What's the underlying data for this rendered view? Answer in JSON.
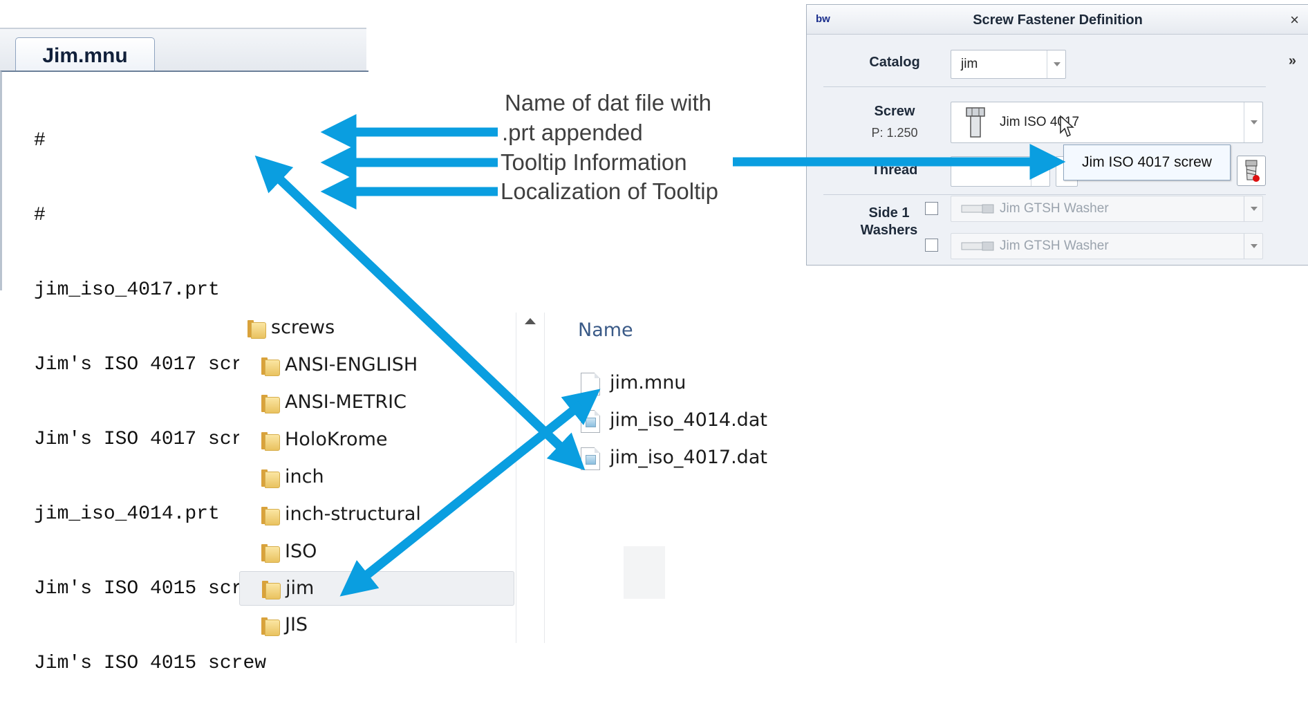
{
  "editor": {
    "tab_label": "Jim.mnu",
    "lines": [
      "#",
      "#",
      "jim_iso_4017.prt",
      "Jim's ISO 4017 screw",
      "Jim's ISO 4017 screw",
      "jim_iso_4014.prt",
      "Jim's ISO 4015 screw",
      "Jim's ISO 4015 screw"
    ]
  },
  "annotations": {
    "dat_name_line1": "Name of dat file with",
    "dat_name_line2": ".prt appended",
    "tooltip_info": "Tooltip Information",
    "tooltip_localization": "Localization of Tooltip"
  },
  "dialog": {
    "app_icon_label": "bw",
    "title": "Screw Fastener Definition",
    "close_label": "×",
    "expand_label": "»",
    "catalog_label": "Catalog",
    "catalog_value": "jim",
    "screw_label": "Screw",
    "pitch_label": "P: 1.250",
    "screw_value": "Jim ISO 4017",
    "thread_label": "Thread",
    "side1_label": "Side 1",
    "washers_label": "Washers",
    "washer1_value": "Jim GTSH Washer",
    "washer2_value": "Jim GTSH Washer",
    "tooltip_text": "Jim ISO 4017 screw"
  },
  "explorer": {
    "folders": [
      "screws",
      "ANSI-ENGLISH",
      "ANSI-METRIC",
      "HoloKrome",
      "inch",
      "inch-structural",
      "ISO",
      "jim",
      "JIS"
    ],
    "selected_folder": "jim",
    "name_header": "Name",
    "files": [
      "jim.mnu",
      "jim_iso_4014.dat",
      "jim_iso_4017.dat"
    ]
  },
  "colors": {
    "arrow": "#0a9ee0",
    "annotation_text": "#3f3f3f",
    "dialog_bg": "#eef1f6",
    "folder_yellow": "#e9c25f"
  }
}
